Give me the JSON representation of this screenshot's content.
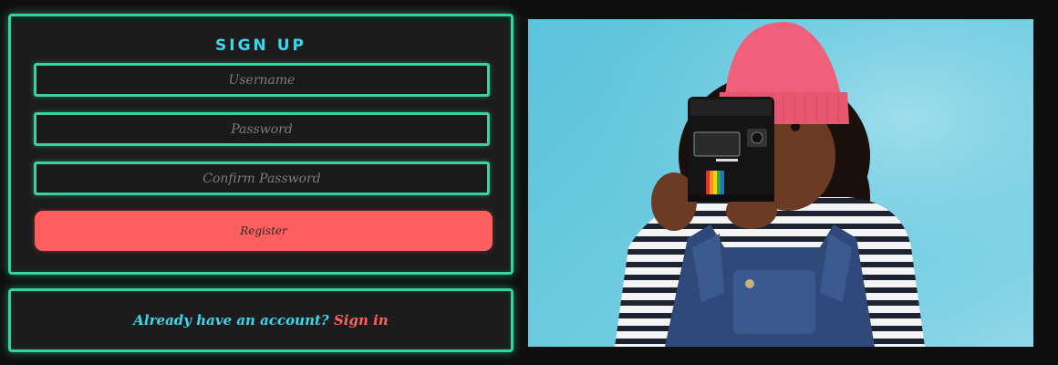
{
  "signup": {
    "title": "Sign up",
    "username_placeholder": "Username",
    "password_placeholder": "Password",
    "confirm_placeholder": "Confirm Password",
    "register_label": "Register"
  },
  "signin": {
    "prompt": "Already have an account?",
    "link_label": "Sign in"
  },
  "colors": {
    "background": "#0f0f0f",
    "panel": "#1c1c1c",
    "accent_border": "#37d39a",
    "title": "#38d8ee",
    "button": "#ff5f5f",
    "link": "#ff5f5f"
  },
  "image": {
    "subject": "child-with-instant-camera-photo"
  }
}
